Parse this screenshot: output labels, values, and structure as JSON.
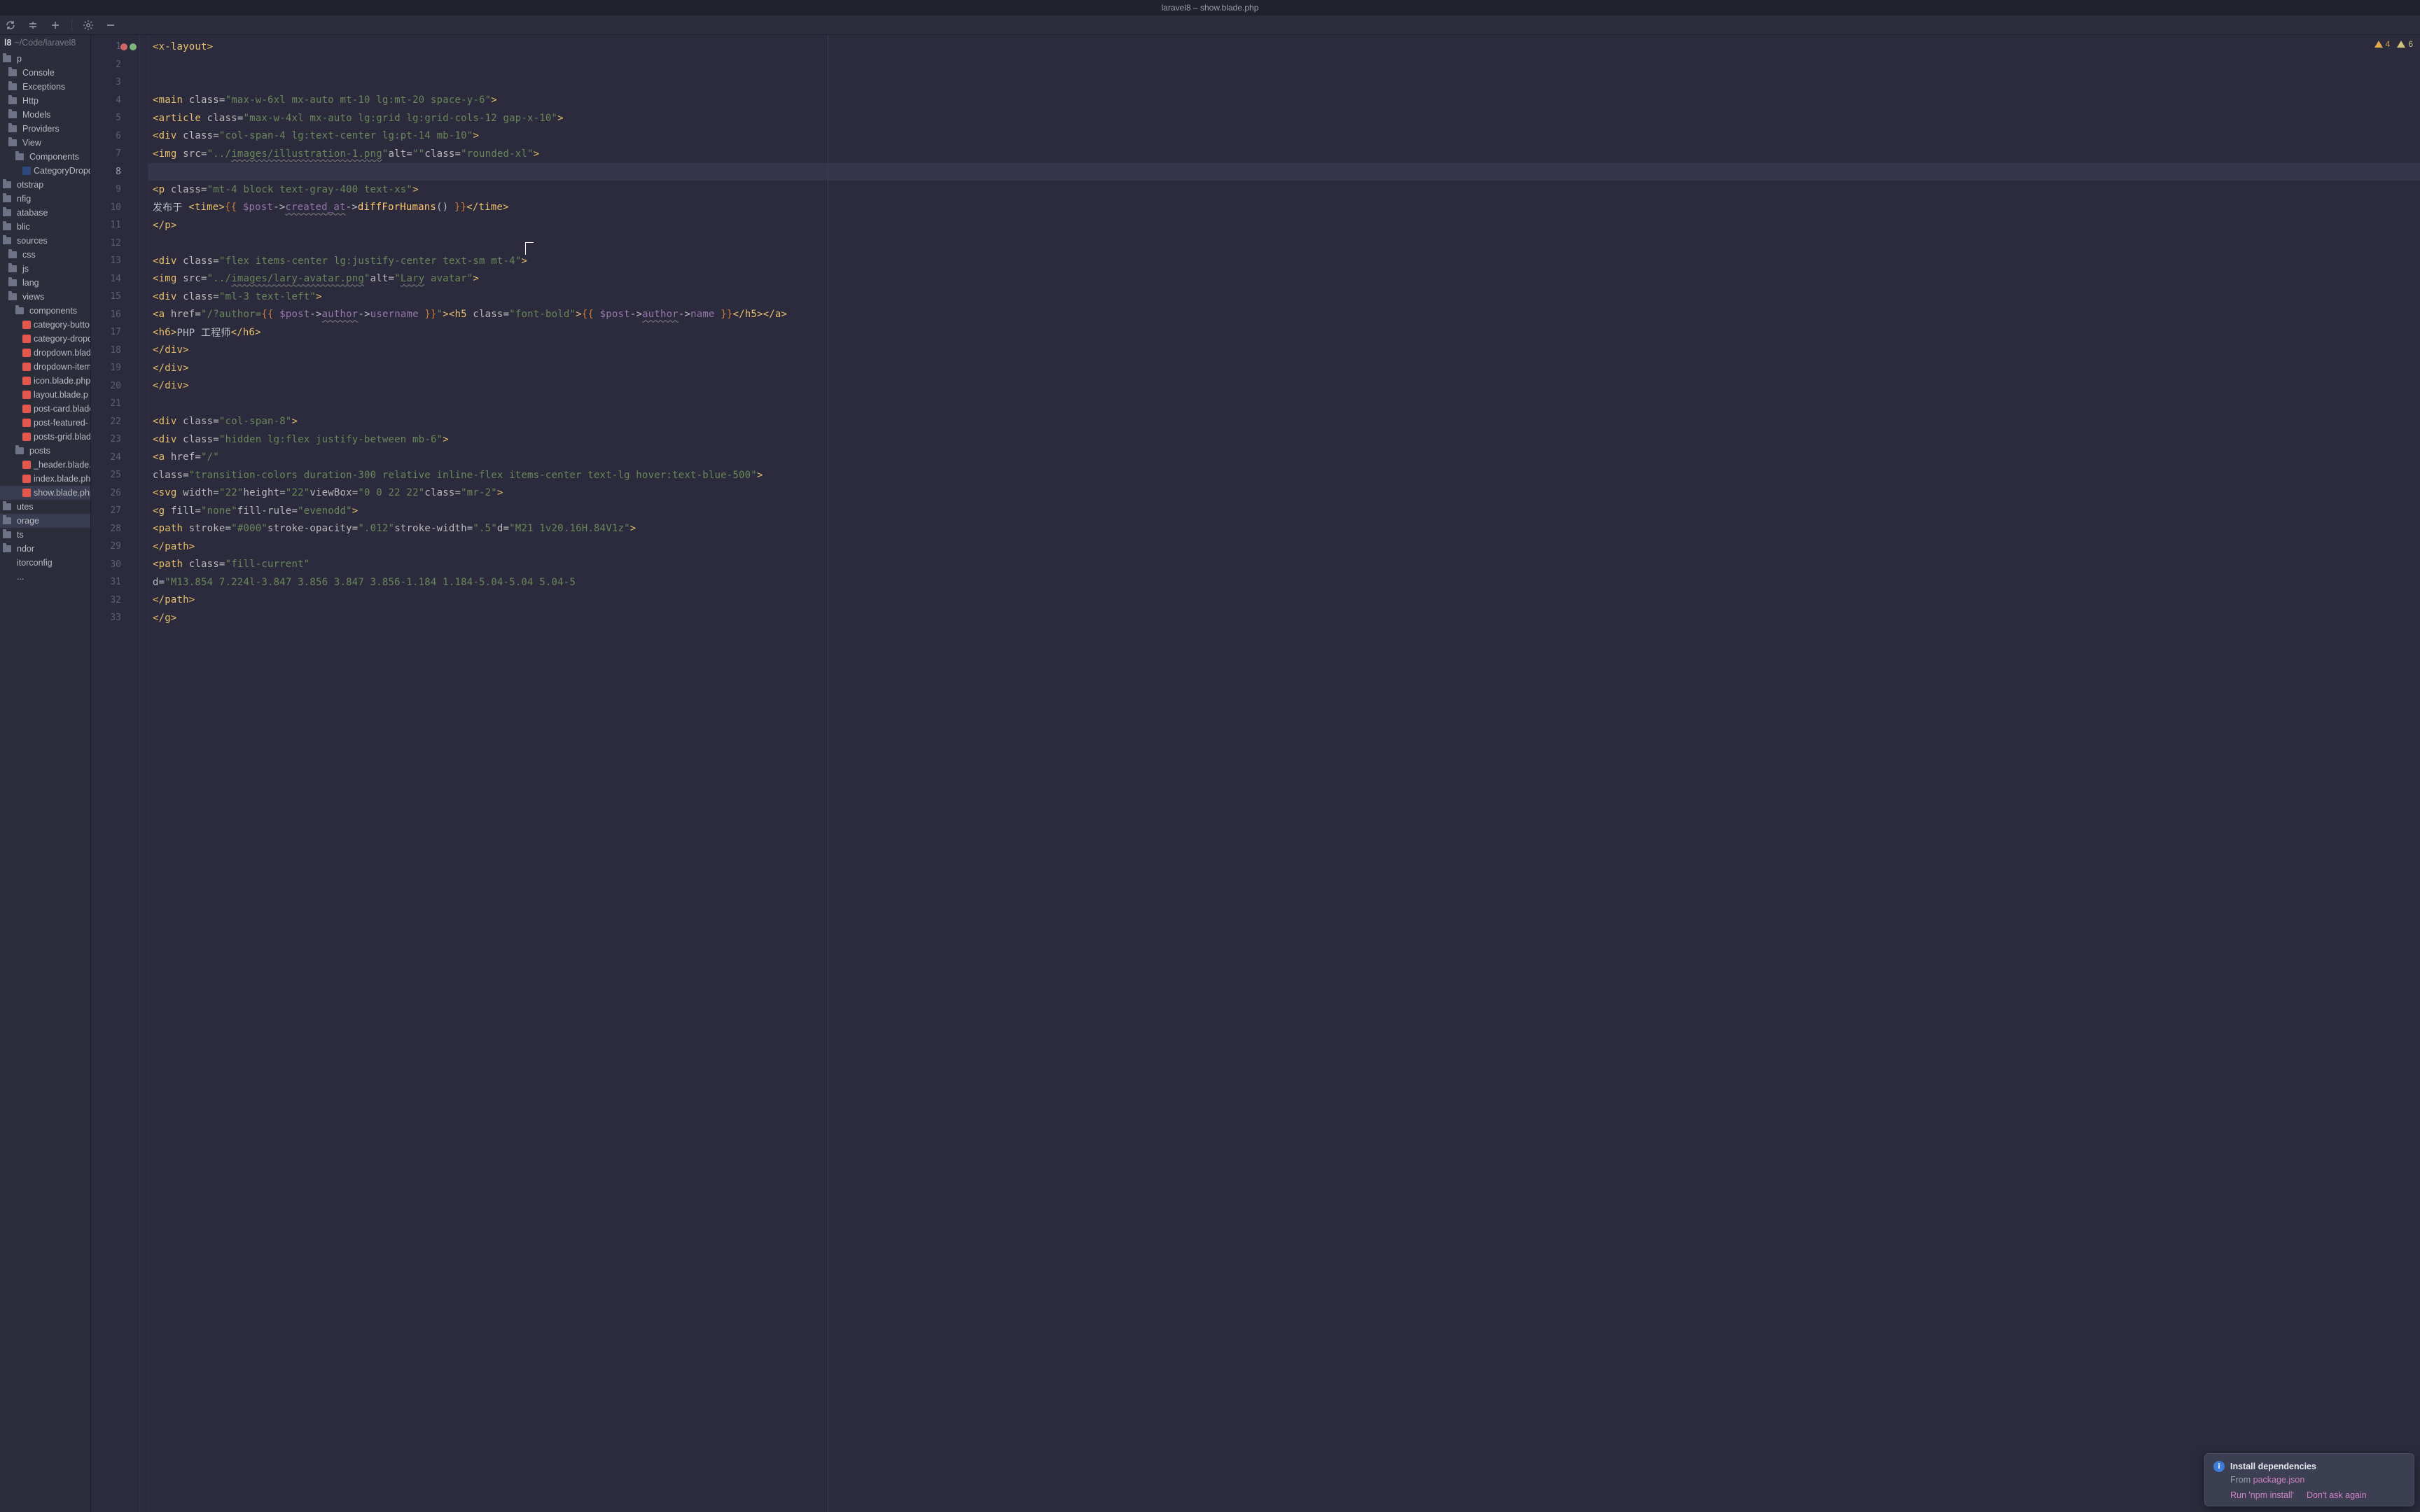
{
  "title": "laravel8 – show.blade.php",
  "warnings": {
    "weak": "4",
    "typo": "6"
  },
  "project": {
    "name": "l8",
    "path": "~/Code/laravel8"
  },
  "tree": [
    {
      "depth": 0,
      "label": "p",
      "type": "folder"
    },
    {
      "depth": 1,
      "label": "Console",
      "type": "folder"
    },
    {
      "depth": 1,
      "label": "Exceptions",
      "type": "folder"
    },
    {
      "depth": 1,
      "label": "Http",
      "type": "folder"
    },
    {
      "depth": 1,
      "label": "Models",
      "type": "folder"
    },
    {
      "depth": 1,
      "label": "Providers",
      "type": "folder"
    },
    {
      "depth": 1,
      "label": "View",
      "type": "folder"
    },
    {
      "depth": 2,
      "label": "Components",
      "type": "folder"
    },
    {
      "depth": 3,
      "label": "CategoryDropd",
      "type": "php"
    },
    {
      "depth": 0,
      "label": "otstrap",
      "type": "folder"
    },
    {
      "depth": 0,
      "label": "nfig",
      "type": "folder"
    },
    {
      "depth": 0,
      "label": "atabase",
      "type": "folder"
    },
    {
      "depth": 0,
      "label": "blic",
      "type": "folder"
    },
    {
      "depth": 0,
      "label": "sources",
      "type": "folder"
    },
    {
      "depth": 1,
      "label": "css",
      "type": "folder"
    },
    {
      "depth": 1,
      "label": "js",
      "type": "folder"
    },
    {
      "depth": 1,
      "label": "lang",
      "type": "folder"
    },
    {
      "depth": 1,
      "label": "views",
      "type": "folder"
    },
    {
      "depth": 2,
      "label": "components",
      "type": "folder"
    },
    {
      "depth": 3,
      "label": "category-butto",
      "type": "blade"
    },
    {
      "depth": 3,
      "label": "category-dropd",
      "type": "blade"
    },
    {
      "depth": 3,
      "label": "dropdown.blade",
      "type": "blade"
    },
    {
      "depth": 3,
      "label": "dropdown-item",
      "type": "blade"
    },
    {
      "depth": 3,
      "label": "icon.blade.php",
      "type": "blade"
    },
    {
      "depth": 3,
      "label": "layout.blade.p",
      "type": "blade"
    },
    {
      "depth": 3,
      "label": "post-card.blade",
      "type": "blade"
    },
    {
      "depth": 3,
      "label": "post-featured-",
      "type": "blade"
    },
    {
      "depth": 3,
      "label": "posts-grid.blad",
      "type": "blade"
    },
    {
      "depth": 2,
      "label": "posts",
      "type": "folder"
    },
    {
      "depth": 3,
      "label": "_header.blade.p",
      "type": "blade"
    },
    {
      "depth": 3,
      "label": "index.blade.ph",
      "type": "blade"
    },
    {
      "depth": 3,
      "label": "show.blade.php",
      "type": "blade",
      "sel": true
    },
    {
      "depth": 0,
      "label": "utes",
      "type": "folder"
    },
    {
      "depth": 0,
      "label": "orage",
      "type": "folder",
      "sel2": true
    },
    {
      "depth": 0,
      "label": "ts",
      "type": "folder"
    },
    {
      "depth": 0,
      "label": "ndor",
      "type": "folder"
    },
    {
      "depth": 0,
      "label": "itorconfig",
      "type": "file"
    },
    {
      "depth": 0,
      "label": "...",
      "type": "file"
    }
  ],
  "notif": {
    "title": "Install dependencies",
    "from": "From ",
    "pkg": "package.json",
    "run": "Run 'npm install'",
    "dont": "Don't ask again"
  },
  "code": [
    {
      "n": 1,
      "hl": false,
      "dots": [
        "g",
        "r"
      ],
      "html": "<span class='t-tag'>&lt;x-layout&gt;</span>"
    },
    {
      "n": 2,
      "html": ""
    },
    {
      "n": 3,
      "html": ""
    },
    {
      "n": 4,
      "html": "    <span class='t-tag'>&lt;main </span><span class='t-attr'>class=</span><span class='t-str'>\"max-w-6xl mx-auto mt-10 lg:mt-20 space-y-6\"</span><span class='t-tag'>&gt;</span>"
    },
    {
      "n": 5,
      "html": "        <span class='t-tag'>&lt;article </span><span class='t-attr'>class=</span><span class='t-str'>\"max-w-4xl mx-auto lg:grid lg:grid-cols-12 gap-x-10\"</span><span class='t-tag'>&gt;</span>"
    },
    {
      "n": 6,
      "html": "            <span class='t-tag'>&lt;div </span><span class='t-attr'>class=</span><span class='t-str'>\"col-span-4 lg:text-center lg:pt-14 mb-10\"</span><span class='t-tag'>&gt;</span>"
    },
    {
      "n": 7,
      "html": "                <span class='t-tag'>&lt;img </span><span class='t-attr'>src=</span><span class='t-str'>\"../<span class='t-wave'>images/illustration-1.png</span>\"</span> <span class='t-attr'>alt=</span><span class='t-str'>\"\"</span> <span class='t-attr'>class=</span><span class='t-str'>\"rounded-xl\"</span><span class='t-tag'>&gt;</span>"
    },
    {
      "n": 8,
      "hl": true,
      "html": ""
    },
    {
      "n": 9,
      "html": "                <span class='t-tag'>&lt;p </span><span class='t-attr'>class=</span><span class='t-str'>\"mt-4 block text-gray-400 text-xs\"</span><span class='t-tag'>&gt;</span>"
    },
    {
      "n": 10,
      "html": "                    <span class='t-plain'>发布于 </span><span class='t-tag'>&lt;time&gt;</span><span class='t-br'>{{ </span><span class='t-var'>$post</span><span class='t-plain'>-&gt;</span><span class='t-var t-wave'>created_at</span><span class='t-plain'>-&gt;</span><span class='t-mth'>diffForHumans</span><span class='t-plain'>()</span><span class='t-br'> }}</span><span class='t-tag'>&lt;/time&gt;</span>"
    },
    {
      "n": 11,
      "html": "                <span class='t-tag'>&lt;/p&gt;</span>"
    },
    {
      "n": 12,
      "html": ""
    },
    {
      "n": 13,
      "html": "                <span class='t-tag'>&lt;div </span><span class='t-attr'>class=</span><span class='t-str'>\"flex items-center lg:justify-center text-sm mt-4\"</span><span class='t-tag'>&gt;</span>"
    },
    {
      "n": 14,
      "html": "                    <span class='t-tag'>&lt;img </span><span class='t-attr'>src=</span><span class='t-str'>\"../<span class='t-wave'>images/lary-avatar.png</span>\"</span> <span class='t-attr'>alt=</span><span class='t-str'>\"<span class='t-wave'>Lary</span> avatar\"</span><span class='t-tag'>&gt;</span>"
    },
    {
      "n": 15,
      "html": "                    <span class='t-tag'>&lt;div </span><span class='t-attr'>class=</span><span class='t-str'>\"ml-3 text-left\"</span><span class='t-tag'>&gt;</span>"
    },
    {
      "n": 16,
      "html": "                        <span class='t-tag'>&lt;a </span><span class='t-attr'>href=</span><span class='t-str'>\"/?author=</span><span class='t-br'>{{ </span><span class='t-var'>$post</span><span class='t-plain'>-&gt;</span><span class='t-var t-wave'>author</span><span class='t-plain'>-&gt;</span><span class='t-var'>username</span><span class='t-br'> }}</span><span class='t-str'>\"</span><span class='t-tag'>&gt;&lt;h5 </span><span class='t-attr'>class=</span><span class='t-str'>\"font-bold\"</span><span class='t-tag'>&gt;</span><span class='t-br'>{{ </span><span class='t-var'>$post</span><span class='t-plain'>-&gt;</span><span class='t-var t-wave'>author</span><span class='t-plain'>-&gt;</span><span class='t-var'>name</span><span class='t-br'> }}</span><span class='t-tag'>&lt;/h5&gt;&lt;/a&gt;</span>"
    },
    {
      "n": 17,
      "html": "                        <span class='t-tag'>&lt;h6&gt;</span><span class='t-plain'>PHP 工程师</span><span class='t-tag'>&lt;/h6&gt;</span>"
    },
    {
      "n": 18,
      "html": "                    <span class='t-tag'>&lt;/div&gt;</span>"
    },
    {
      "n": 19,
      "html": "                <span class='t-tag'>&lt;/div&gt;</span>"
    },
    {
      "n": 20,
      "html": "            <span class='t-tag'>&lt;/div&gt;</span>"
    },
    {
      "n": 21,
      "html": ""
    },
    {
      "n": 22,
      "html": "            <span class='t-tag'>&lt;div </span><span class='t-attr'>class=</span><span class='t-str'>\"col-span-8\"</span><span class='t-tag'>&gt;</span>"
    },
    {
      "n": 23,
      "html": "                <span class='t-tag'>&lt;div </span><span class='t-attr'>class=</span><span class='t-str'>\"hidden lg:flex justify-between mb-6\"</span><span class='t-tag'>&gt;</span>"
    },
    {
      "n": 24,
      "html": "                    <span class='t-tag'>&lt;a </span><span class='t-attr'>href=</span><span class='t-str'>\"/\"</span>"
    },
    {
      "n": 25,
      "html": "                       <span class='t-attr'>class=</span><span class='t-str'>\"transition-colors duration-300 relative inline-flex items-center text-lg hover:text-blue-500\"</span><span class='t-tag'>&gt;</span>"
    },
    {
      "n": 26,
      "html": "                        <span class='t-tag'>&lt;svg </span><span class='t-attr'>width=</span><span class='t-str'>\"22\"</span> <span class='t-attr'>height=</span><span class='t-str'>\"22\"</span> <span class='t-attr'>viewBox=</span><span class='t-str'>\"0 0 22 22\"</span> <span class='t-attr'>class=</span><span class='t-str'>\"mr-2\"</span><span class='t-tag'>&gt;</span>"
    },
    {
      "n": 27,
      "html": "                            <span class='t-tag'>&lt;g </span><span class='t-attr'>fill=</span><span class='t-str'>\"none\"</span> <span class='t-attr'>fill-rule=</span><span class='t-str'>\"evenodd\"</span><span class='t-tag'>&gt;</span>"
    },
    {
      "n": 28,
      "html": "                                <span class='t-tag'>&lt;path </span><span class='t-attr'>stroke=</span><span class='t-str'>\"#000\"</span> <span class='t-attr'>stroke-opacity=</span><span class='t-str'>\".012\"</span> <span class='t-attr'>stroke-width=</span><span class='t-str'>\".5\"</span> <span class='t-attr'>d=</span><span class='t-str'>\"M21 1v20.16H.84V1z\"</span><span class='t-tag'>&gt;</span>"
    },
    {
      "n": 29,
      "html": "                                <span class='t-tag'>&lt;/path&gt;</span>"
    },
    {
      "n": 30,
      "html": "                                <span class='t-tag'>&lt;path </span><span class='t-attr'>class=</span><span class='t-str'>\"fill-current\"</span>"
    },
    {
      "n": 31,
      "html": "                                      <span class='t-attr'>d=</span><span class='t-str'>\"M13.854 7.224l-3.847 3.856 3.847 3.856-1.184 1.184-5.04-5.04 5.04-5</span>"
    },
    {
      "n": 32,
      "html": "                                <span class='t-tag'>&lt;/path&gt;</span>"
    },
    {
      "n": 33,
      "html": "                            <span class='t-tag'>&lt;/g&gt;</span>"
    }
  ]
}
